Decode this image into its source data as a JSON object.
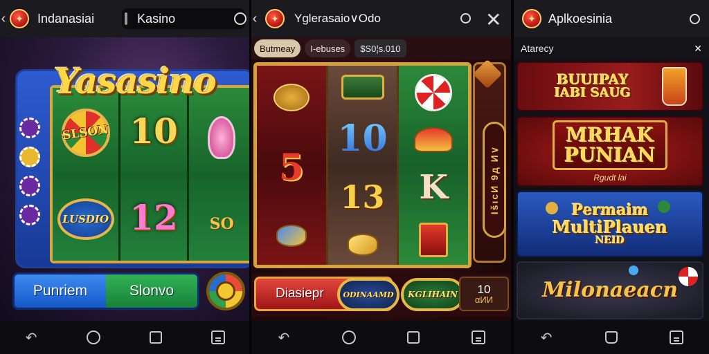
{
  "panel1": {
    "topbar": {
      "title": "Indanasiai",
      "tab": "Kasino"
    },
    "logo": "Yasasino",
    "reels": {
      "col1": {
        "wheel_label": "SLSON",
        "medal_label": "LUSDIO"
      },
      "col2": {
        "top": "10",
        "bottom": "12"
      },
      "col3": {
        "bottom_label": "SO"
      }
    },
    "buttons": {
      "left": "Punriem",
      "right": "Slonvo"
    }
  },
  "panel2": {
    "topbar": {
      "title": "Yglerasaio∨Odo"
    },
    "chips": [
      "Butmeay",
      "I-ebuses",
      "$S0¦s.010"
    ],
    "reels": {
      "col1": {
        "symbol": "5"
      },
      "col2": {
        "top": "10",
        "middle": "13"
      },
      "col3": {
        "middle": "K"
      }
    },
    "side_label": "IšıсИ 9д И∨",
    "bottom": {
      "button": "Diasiepr",
      "badge1": "ODINAAMD",
      "badge2": "KGLIHAIN",
      "value_top": "10",
      "value_bottom": "αИИ"
    }
  },
  "panel3": {
    "topbar": {
      "title": "Aplkoesinia"
    },
    "section_label": "Atarecy",
    "promos": [
      {
        "line1": "BUUIPAY",
        "line2": "IABI SAUG"
      },
      {
        "line1": "MRHAK",
        "line2": "PUNIAN",
        "sub": "Rgudt lai"
      },
      {
        "line1": "Permaim",
        "line2": "MultiPlauen",
        "line3": "NEID"
      },
      {
        "line1": "Milonaeacn"
      }
    ]
  },
  "colors": {
    "gold": "#ffd85a",
    "brand_red": "#c4161c",
    "reel_green": "#17642a"
  }
}
